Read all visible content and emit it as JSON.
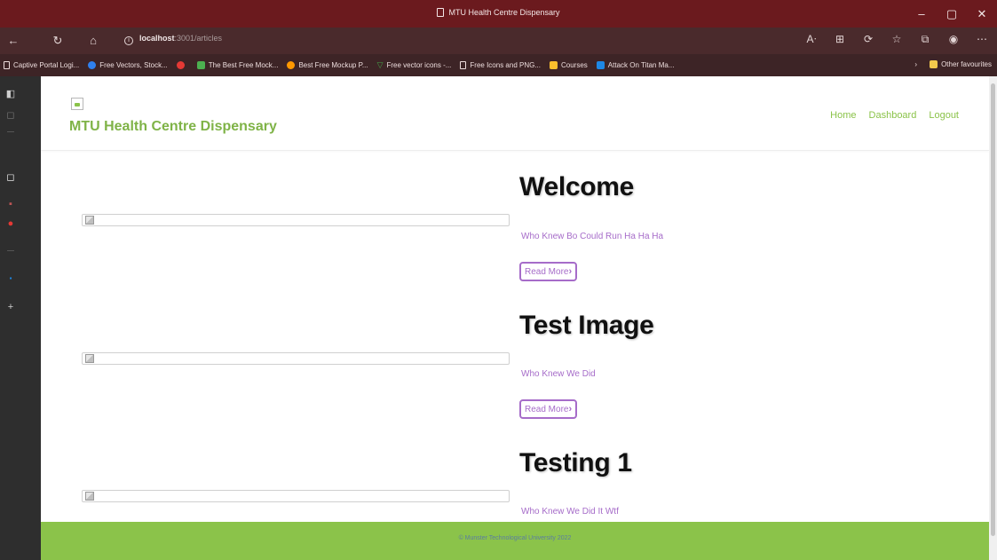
{
  "window": {
    "title": "MTU Health Centre Dispensary"
  },
  "browser": {
    "url_host": "localhost",
    "url_path": ":3001/articles",
    "bookmarks": [
      {
        "label": "Captive Portal Logi...",
        "color": "#eddddd",
        "kind": "doc"
      },
      {
        "label": "Free Vectors, Stock...",
        "color": "#2f80ed",
        "kind": "dot"
      },
      {
        "label": "",
        "color": "#e53935",
        "kind": "dot"
      },
      {
        "label": "The Best Free Mock...",
        "color": "#4caf50",
        "kind": "dot"
      },
      {
        "label": "Best Free Mockup P...",
        "color": "#ff9800",
        "kind": "dot"
      },
      {
        "label": "Free vector icons -...",
        "color": "#43a047",
        "kind": "tri"
      },
      {
        "label": "Free Icons and PNG...",
        "color": "#eddddd",
        "kind": "doc"
      },
      {
        "label": "Courses",
        "color": "#fbc02d",
        "kind": "dot"
      },
      {
        "label": "Attack On Titan Ma...",
        "color": "#1e88e5",
        "kind": "dot"
      }
    ],
    "other_favourites": "Other favourites"
  },
  "site": {
    "brand": "MTU Health Centre Dispensary",
    "nav": [
      "Home",
      "Dashboard",
      "Logout"
    ],
    "footer": "© Munster Technological University 2022"
  },
  "articles": [
    {
      "title": "Welcome",
      "description": "Who Knew Bo Could Run Ha Ha Ha",
      "read_more": "Read More"
    },
    {
      "title": "Test Image",
      "description": "Who Knew We Did",
      "read_more": "Read More"
    },
    {
      "title": "Testing 1",
      "description": "Who Knew We Did It Wtf",
      "read_more": "Read More"
    }
  ],
  "colors": {
    "brand_green": "#8bc34a",
    "accent_purple": "#a66cc9",
    "titlebar": "#6b1a1e"
  }
}
